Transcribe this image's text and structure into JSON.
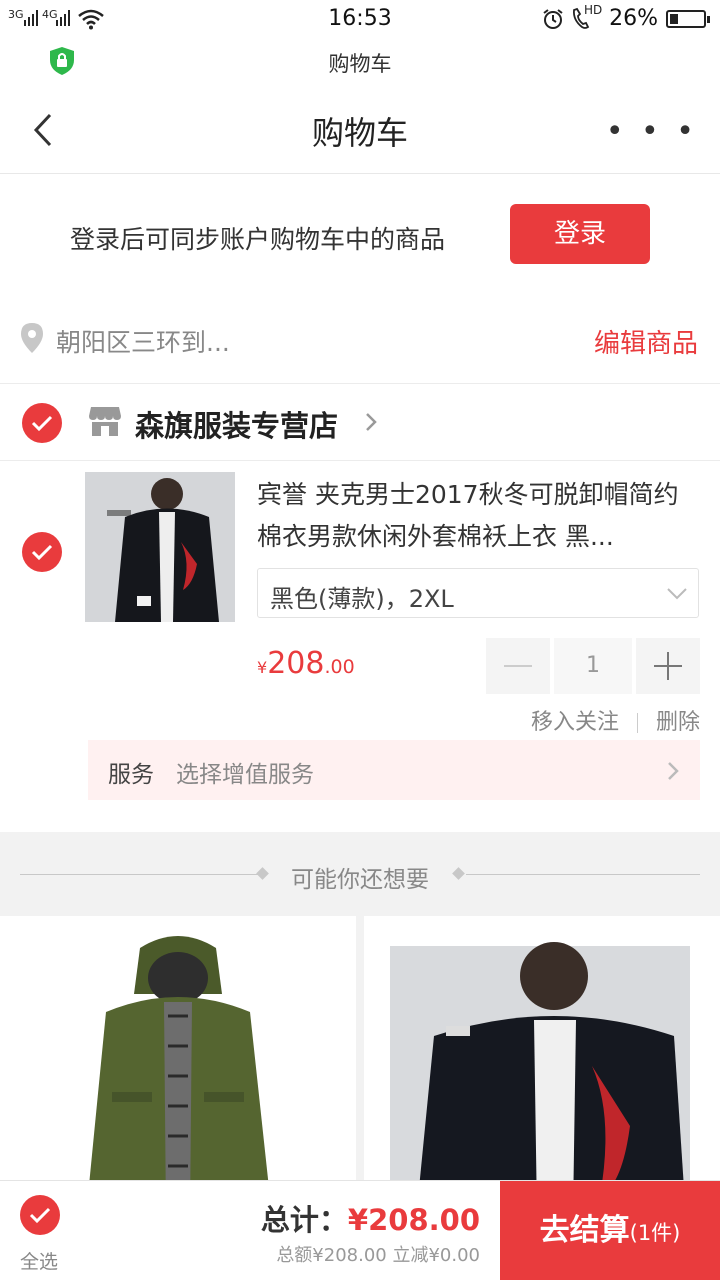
{
  "status_bar": {
    "network_left": "3G",
    "network_right": "4G",
    "time": "16:53",
    "hd_label": "HD",
    "battery_percent": "26%",
    "battery_level": 0.26
  },
  "browser": {
    "site_title": "购物车"
  },
  "nav": {
    "title": "购物车",
    "more": "• • •"
  },
  "login_banner": {
    "text": "登录后可同步账户购物车中的商品",
    "button": "登录"
  },
  "address": {
    "text": "朝阳区三环到...",
    "edit_label": "编辑商品"
  },
  "shop": {
    "name": "森旗服装专营店"
  },
  "item": {
    "title": "宾誉 夹克男士2017秋冬可脱卸帽简约棉衣男款休闲外套棉袄上衣 黑...",
    "spec": "黑色(薄款)，2XL",
    "price_currency": "¥",
    "price_int": "208",
    "price_dec": ".00",
    "quantity": "1",
    "move_to_favorites": "移入关注",
    "delete": "删除",
    "service_label": "服务",
    "service_value": "选择增值服务"
  },
  "recommend": {
    "header": "可能你还想要"
  },
  "footer": {
    "select_all": "全选",
    "total_label": "总计：",
    "total_amount": "¥208.00",
    "subtotal": "总额¥208.00 立减¥0.00",
    "checkout": "去结算",
    "count": "(1件)"
  },
  "colors": {
    "accent": "#e93b3d",
    "service_bg": "#fff1f1",
    "section_bg": "#f2f2f2"
  },
  "icons": [
    "wifi-icon",
    "alarm-icon",
    "call-hd-icon",
    "battery-icon",
    "shield-lock-icon",
    "back-icon",
    "more-icon",
    "location-pin-icon",
    "store-icon",
    "check-icon",
    "chevron-right-icon",
    "chevron-down-icon",
    "minus-icon",
    "plus-icon"
  ]
}
